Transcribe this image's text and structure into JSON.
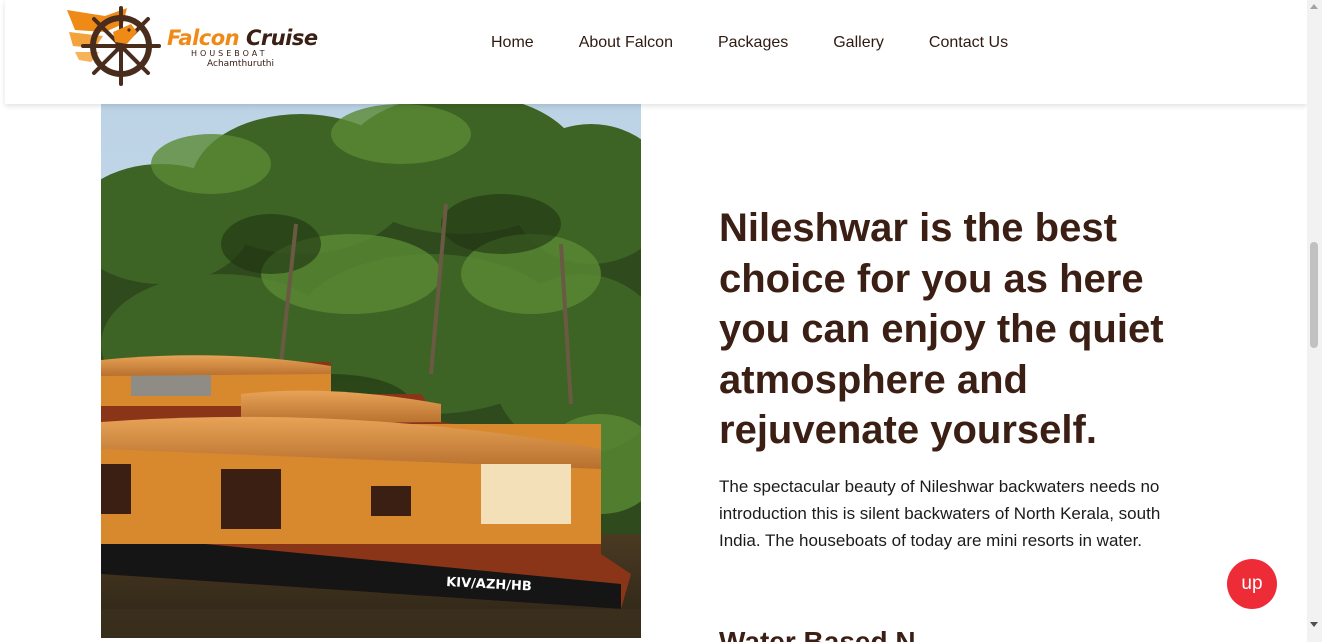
{
  "brand": {
    "name_part1": "Falcon",
    "name_part2": "Cruise",
    "subtitle": "HOUSEBOAT",
    "location": "Achamthuruthi"
  },
  "nav": {
    "items": [
      {
        "label": "Home"
      },
      {
        "label": "About Falcon"
      },
      {
        "label": "Packages"
      },
      {
        "label": "Gallery"
      },
      {
        "label": "Contact Us"
      }
    ]
  },
  "hero": {
    "image_alt": "Houseboat among coconut palms",
    "boat_registration": "KIV/AZH/HB"
  },
  "content": {
    "headline": "Nileshwar is the best choice for you as here you can enjoy the quiet atmosphere and rejuvenate yourself.",
    "description": "The spectacular beauty of Nileshwar backwaters needs no introduction this is silent backwaters of North Kerala, south India. The houseboats of today are mini resorts in water.",
    "next_heading_partial": "Water Based N"
  },
  "up_button": {
    "label": "up"
  },
  "colors": {
    "brand_orange": "#f08a17",
    "brand_brown": "#3b1f14",
    "up_button": "#ee2c38"
  }
}
